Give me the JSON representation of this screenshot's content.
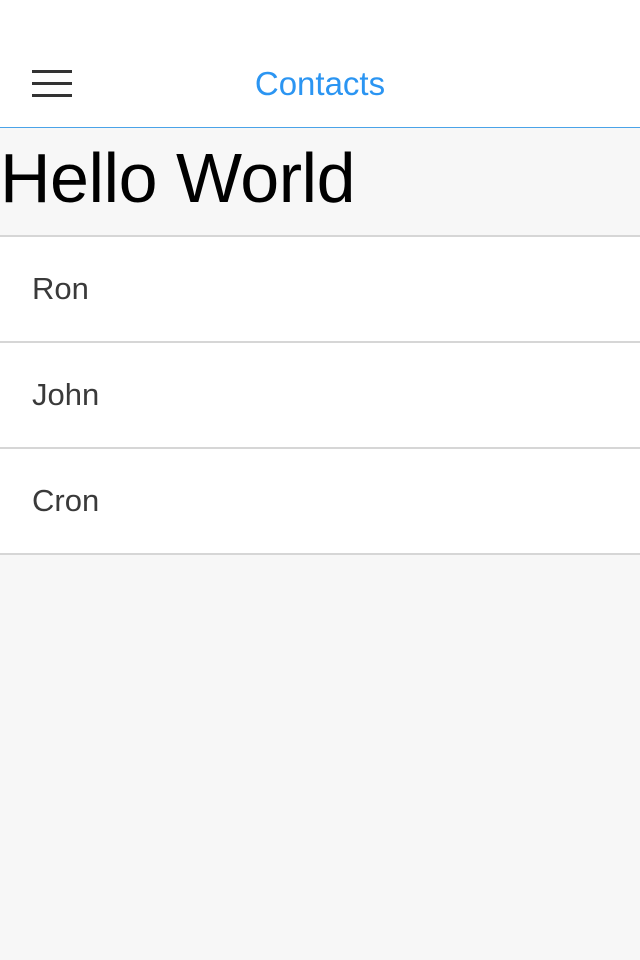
{
  "header": {
    "title": "Contacts",
    "menu_icon": "hamburger-menu-icon",
    "accent_color": "#2b95f2"
  },
  "main": {
    "heading": "Hello World",
    "contacts": [
      {
        "name": "Ron"
      },
      {
        "name": "John"
      },
      {
        "name": "Cron"
      }
    ]
  }
}
